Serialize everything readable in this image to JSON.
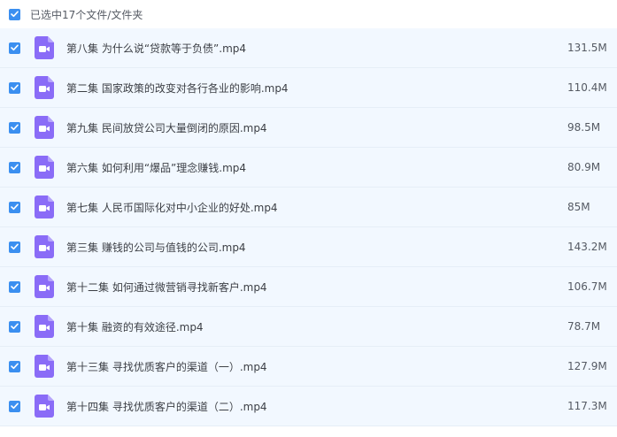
{
  "header": {
    "select_label": "已选中17个文件/文件夹",
    "checked": true
  },
  "colors": {
    "checkbox": "#3b8ff0",
    "video_icon": "#8a6cf7",
    "row_background": "#f2f8ff",
    "row_divider": "#e6eef7"
  },
  "file_icon": "video-file-icon",
  "files": [
    {
      "name": "第八集 为什么说“贷款等于负债”.mp4",
      "size": "131.5M",
      "checked": true
    },
    {
      "name": "第二集 国家政策的改变对各行各业的影响.mp4",
      "size": "110.4M",
      "checked": true
    },
    {
      "name": "第九集 民间放贷公司大量倒闭的原因.mp4",
      "size": "98.5M",
      "checked": true
    },
    {
      "name": "第六集 如何利用“爆品”理念赚钱.mp4",
      "size": "80.9M",
      "checked": true
    },
    {
      "name": "第七集 人民币国际化对中小企业的好处.mp4",
      "size": "85M",
      "checked": true
    },
    {
      "name": "第三集 赚钱的公司与值钱的公司.mp4",
      "size": "143.2M",
      "checked": true
    },
    {
      "name": "第十二集 如何通过微营销寻找新客户.mp4",
      "size": "106.7M",
      "checked": true
    },
    {
      "name": "第十集 融资的有效途径.mp4",
      "size": "78.7M",
      "checked": true
    },
    {
      "name": "第十三集 寻找优质客户的渠道（一）.mp4",
      "size": "127.9M",
      "checked": true
    },
    {
      "name": "第十四集 寻找优质客户的渠道（二）.mp4",
      "size": "117.3M",
      "checked": true
    }
  ]
}
